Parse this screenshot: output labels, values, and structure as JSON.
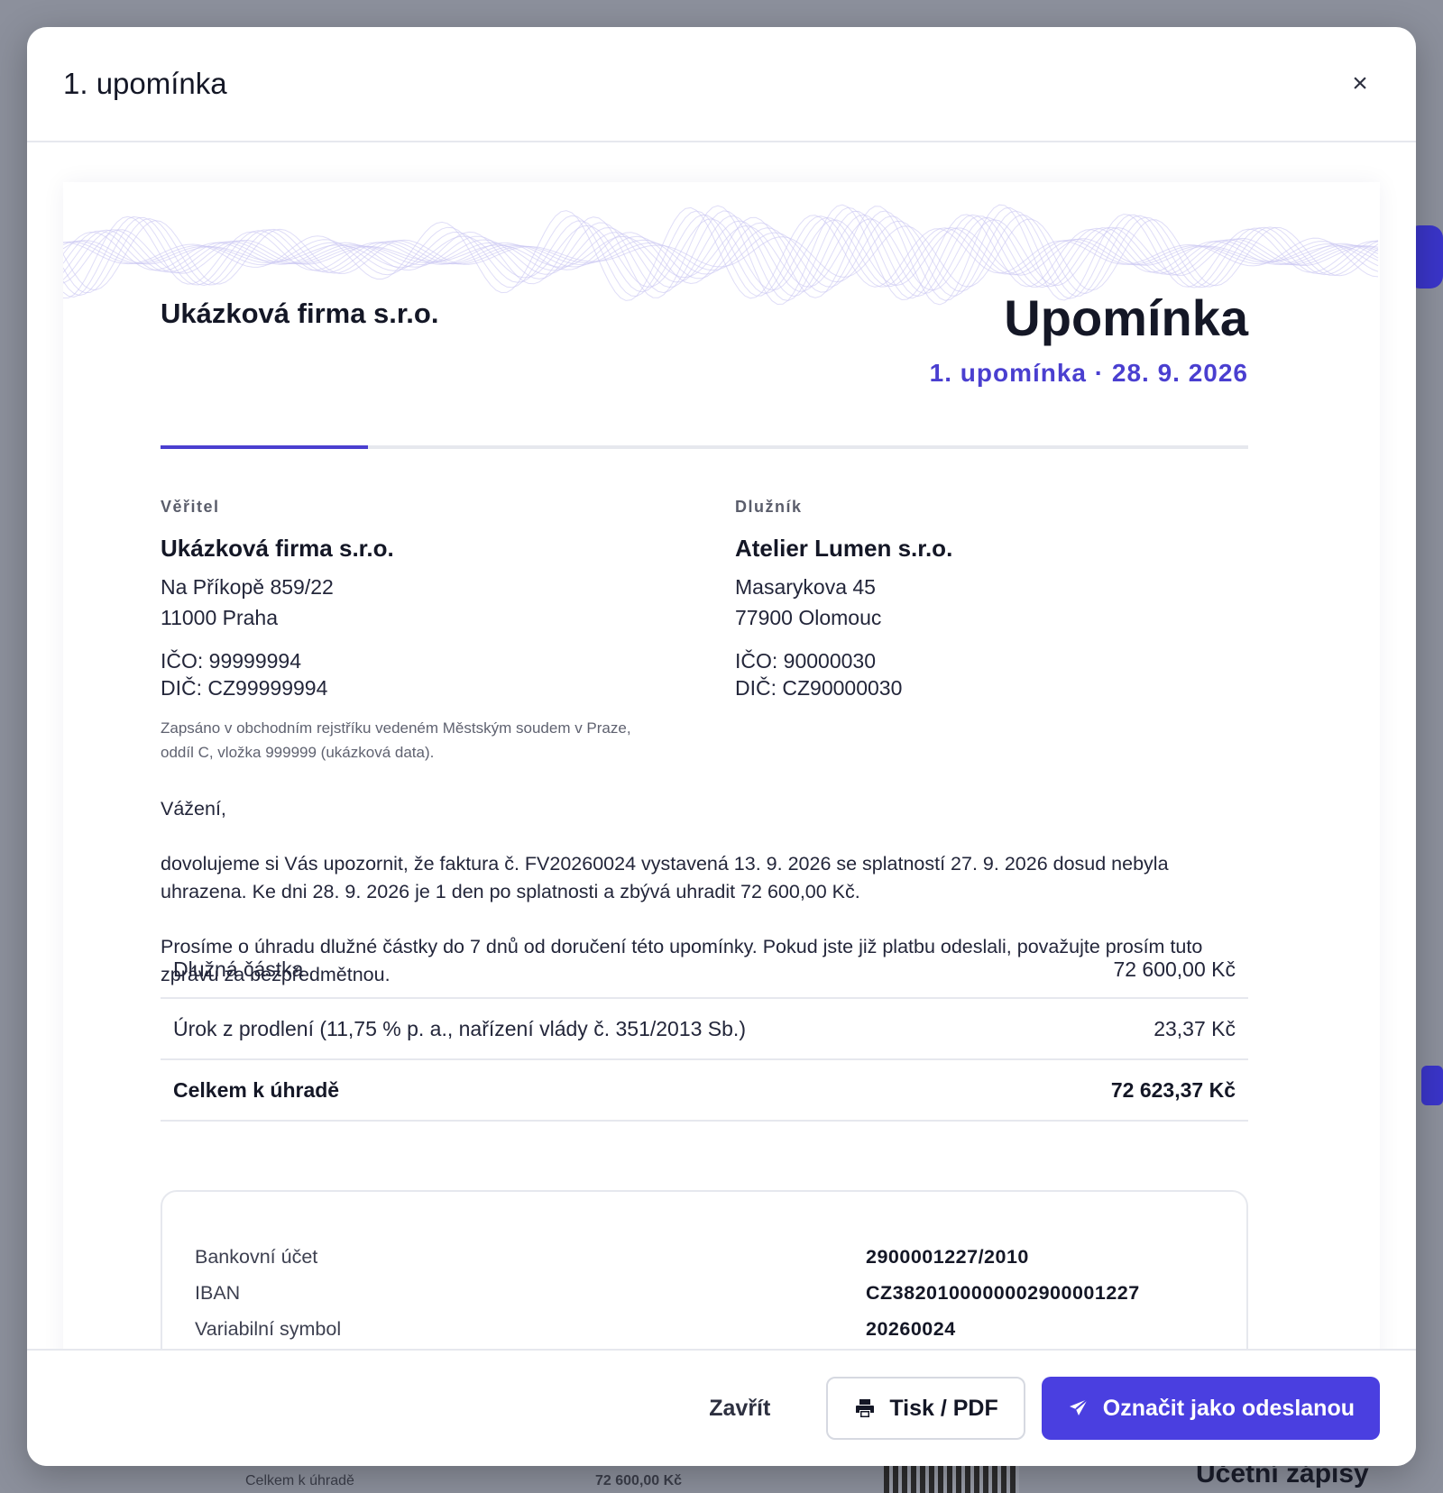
{
  "modal": {
    "title": "1. upomínka",
    "close_glyph": "×"
  },
  "document": {
    "company": "Ukázková firma s.r.o.",
    "title": "Upomínka",
    "subtitle": "1. upomínka · 28. 9. 2026",
    "creditor": {
      "label": "Věřitel",
      "name": "Ukázková firma s.r.o.",
      "street": "Na Příkopě 859/22",
      "city": "11000 Praha",
      "ico": "IČO: 99999994",
      "dic": "DIČ: CZ99999994",
      "note": "Zapsáno v obchodním rejstříku vedeném Městským soudem v Praze, oddíl C, vložka 999999 (ukázková data)."
    },
    "debtor": {
      "label": "Dlužník",
      "name": "Atelier Lumen s.r.o.",
      "street": "Masarykova 45",
      "city": "77900 Olomouc",
      "ico": "IČO: 90000030",
      "dic": "DIČ: CZ90000030"
    },
    "letter": {
      "greeting": "Vážení,",
      "p1": "dovolujeme si Vás upozornit, že faktura č. FV20260024 vystavená 13. 9. 2026 se splatností 27. 9. 2026 dosud nebyla uhrazena. Ke dni 28. 9. 2026 je 1 den po splatnosti a zbývá uhradit 72 600,00 Kč.",
      "p2": "Prosíme o úhradu dlužné částky do 7 dnů od doručení této upomínky. Pokud jste již platbu odeslali, považujte prosím tuto zprávu za bezpředmětnou."
    },
    "summary": [
      {
        "label": "Dlužná částka",
        "value": "72 600,00 Kč"
      },
      {
        "label": "Úrok z prodlení (11,75 % p. a., nařízení vlády č. 351/2013 Sb.)",
        "value": "23,37 Kč"
      },
      {
        "label": "Celkem k úhradě",
        "value": "72 623,37 Kč"
      }
    ],
    "bank": [
      {
        "label": "Bankovní účet",
        "value": "2900001227/2010"
      },
      {
        "label": "IBAN",
        "value": "CZ3820100000002900001227"
      },
      {
        "label": "Variabilní symbol",
        "value": "20260024"
      }
    ]
  },
  "footer": {
    "close_label": "Zavřít",
    "print_label": "Tisk / PDF",
    "print_icon": "printer-icon",
    "send_label": "Označit jako odeslanou",
    "send_icon": "paper-plane-icon"
  },
  "background": {
    "total_label": "Celkem k úhradě",
    "total_value": "72 600,00 Kč",
    "section_title": "Účetní zápisy"
  },
  "colors": {
    "accent": "#4a3fd0",
    "primary_button": "#4a3fe0",
    "overlay": "#8c909c"
  }
}
